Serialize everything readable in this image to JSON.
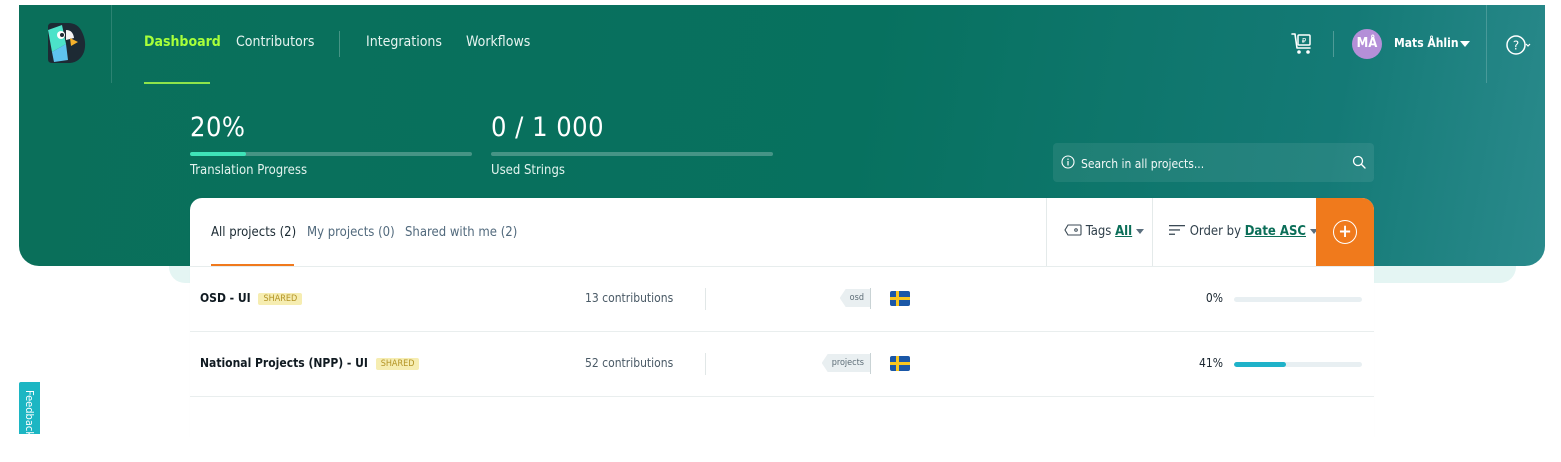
{
  "nav": {
    "items": [
      {
        "label": "Dashboard",
        "active": true
      },
      {
        "label": "Contributors",
        "active": false
      },
      {
        "label": "Integrations",
        "active": false
      },
      {
        "label": "Workflows",
        "active": false
      }
    ]
  },
  "user": {
    "initials": "MÅ",
    "name": "Mats Åhlin",
    "avatar_color": "#b48fd8"
  },
  "stats": {
    "translation_progress": {
      "value": "20%",
      "label": "Translation Progress",
      "fill": 0.2
    },
    "used_strings": {
      "value": "0 / 1 000",
      "label": "Used Strings",
      "fill": 0
    }
  },
  "search": {
    "placeholder": "Search in all projects..."
  },
  "tabs": [
    {
      "label": "All projects (2)",
      "active": true
    },
    {
      "label": "My projects (0)",
      "active": false
    },
    {
      "label": "Shared with me (2)",
      "active": false
    }
  ],
  "filters": {
    "tags_label": "Tags",
    "tags_value": "All",
    "order_label": "Order by",
    "order_value": "Date ASC"
  },
  "projects": [
    {
      "name": "OSD - UI",
      "badge": "SHARED",
      "contributions": "13 contributions",
      "tag": "osd",
      "language": "Swedish",
      "progress_label": "0%",
      "progress": 0
    },
    {
      "name": "National Projects (NPP) - UI",
      "badge": "SHARED",
      "contributions": "52 contributions",
      "tag": "projects",
      "language": "Swedish",
      "progress_label": "41%",
      "progress": 0.41
    }
  ],
  "feedback": {
    "label": "Feedback"
  },
  "colors": {
    "header": "#07715f",
    "accent_green": "#a7ff3a",
    "accent_orange": "#f07a1c",
    "progress_teal": "#1fb2c9",
    "badge_bg": "#f6edb1"
  },
  "icons": [
    "logo-icon",
    "cart-icon",
    "chevron-down-icon",
    "help-icon",
    "info-icon",
    "search-icon",
    "tag-icon",
    "sort-icon",
    "plus-icon",
    "sweden-flag-icon"
  ]
}
